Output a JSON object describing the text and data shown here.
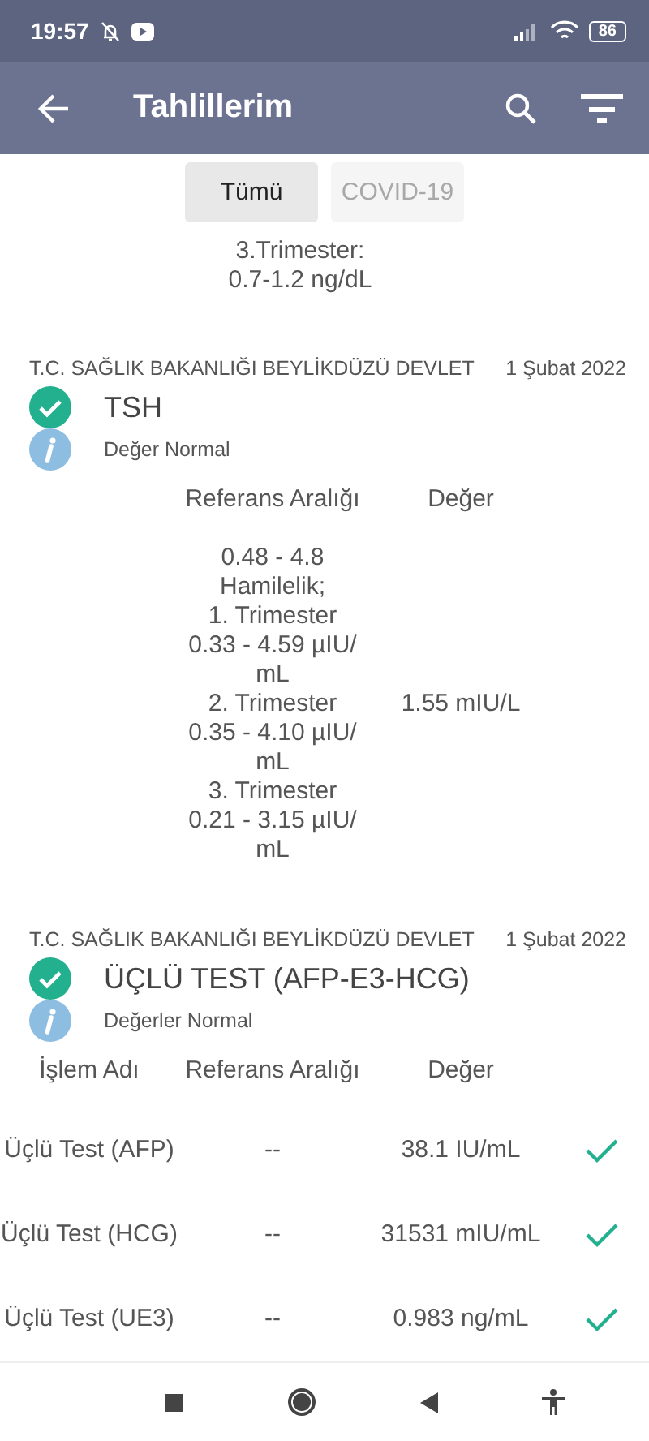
{
  "status_bar": {
    "time": "19:57",
    "battery": "86"
  },
  "app_bar": {
    "title": "Tahlillerim"
  },
  "filters": [
    {
      "label": "Tümü",
      "selected": true
    },
    {
      "label": "COVID-19",
      "selected": false
    }
  ],
  "fragment": {
    "lines": [
      "3.Trimester:",
      "0.7-1.2 ng/dL"
    ]
  },
  "results": [
    {
      "institution": "T.C. SAĞLIK BAKANLIĞI BEYLİKDÜZÜ DEVLET",
      "date": "1 Şubat 2022",
      "title": "TSH",
      "verified": true,
      "status": "Değer Normal",
      "columns": [
        {
          "kind": "range",
          "label": "Referans Aralığı"
        },
        {
          "kind": "value",
          "label": "Değer"
        }
      ],
      "rows": [
        {
          "range_lines": [
            "0.48 - 4.8",
            "Hamilelik;",
            "1. Trimester",
            "0.33 - 4.59 µIU/",
            "mL",
            "2. Trimester",
            "0.35 - 4.10 µIU/",
            "mL",
            "3. Trimester",
            "0.21 - 3.15 µIU/",
            "mL"
          ],
          "value": "1.55 mIU/L",
          "normal": false
        }
      ]
    },
    {
      "institution": "T.C. SAĞLIK BAKANLIĞI BEYLİKDÜZÜ DEVLET",
      "date": "1 Şubat 2022",
      "title": "ÜÇLÜ TEST (AFP-E3-HCG)",
      "verified": true,
      "status": "Değerler Normal",
      "columns": [
        {
          "kind": "name",
          "label": "İşlem Adı"
        },
        {
          "kind": "range",
          "label": "Referans Aralığı"
        },
        {
          "kind": "value",
          "label": "Değer"
        }
      ],
      "rows": [
        {
          "name": "Üçlü Test (AFP)",
          "range_lines": [
            "--"
          ],
          "value": "38.1 IU/mL",
          "normal": true
        },
        {
          "name": "Üçlü Test (HCG)",
          "range_lines": [
            "--"
          ],
          "value": "31531 mIU/mL",
          "normal": true
        },
        {
          "name": "Üçlü Test (UE3)",
          "range_lines": [
            "--"
          ],
          "value": "0.983 ng/mL",
          "normal": true
        }
      ]
    }
  ]
}
